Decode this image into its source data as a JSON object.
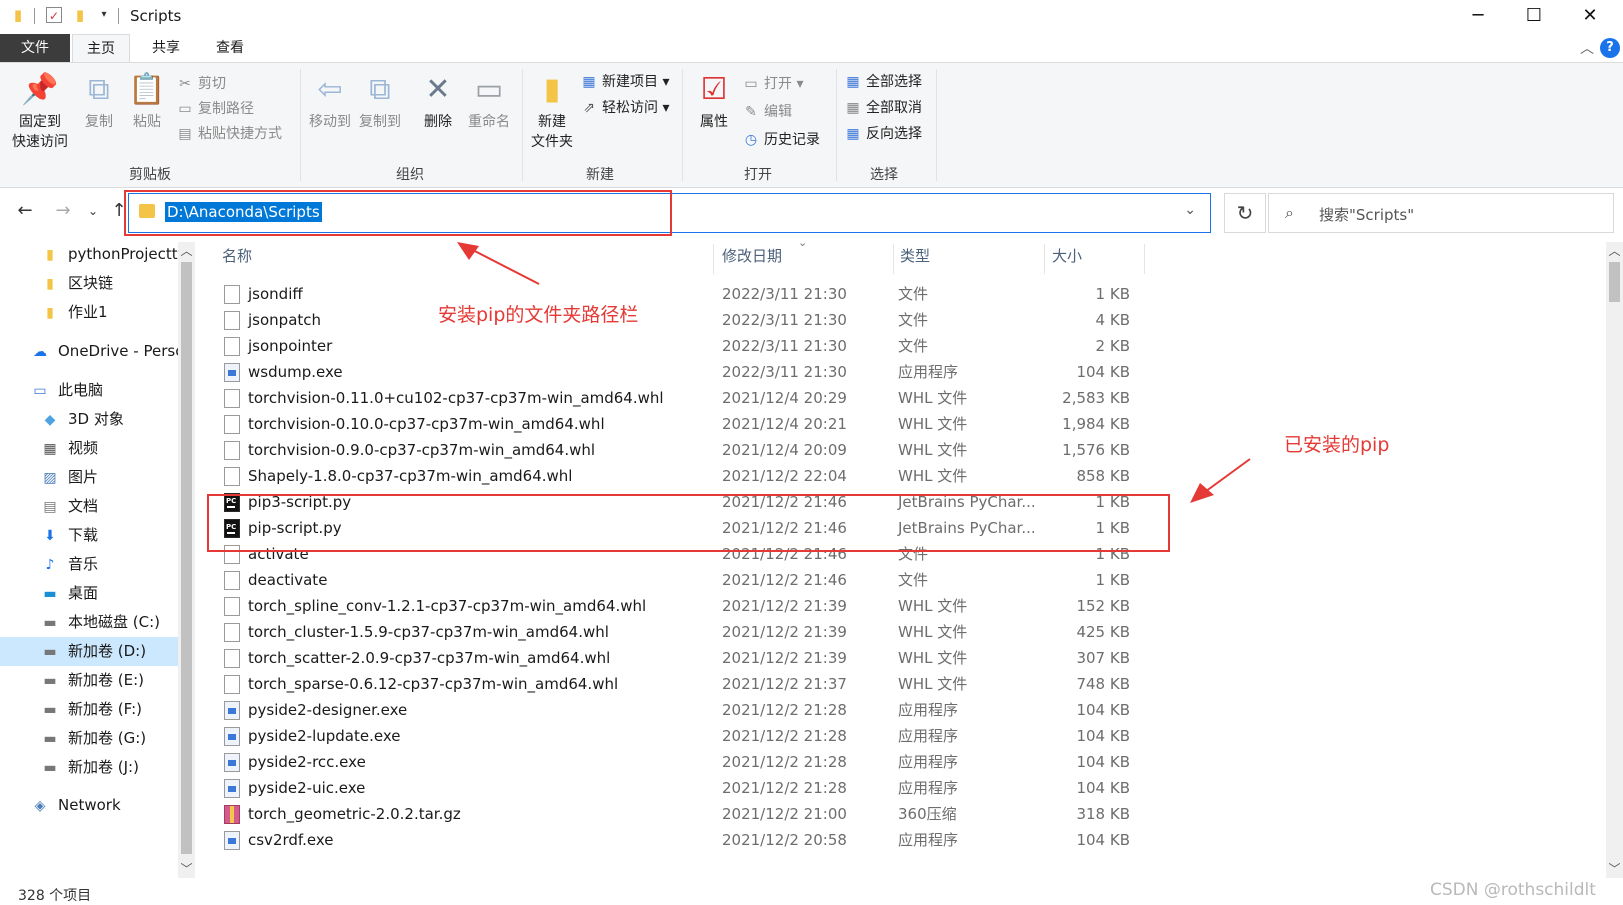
{
  "window": {
    "title": "Scripts",
    "controls": {
      "minimize": "─",
      "maximize": "☐",
      "close": "✕"
    }
  },
  "ribbon": {
    "tabs": [
      "文件",
      "主页",
      "共享",
      "查看"
    ],
    "help": "?",
    "groups": {
      "clipboard": {
        "label": "剪贴板",
        "pin": "固定到\n快速访问",
        "pin_l1": "固定到",
        "pin_l2": "快速访问",
        "copy": "复制",
        "paste": "粘贴",
        "cut": "剪切",
        "copy_path": "复制路径",
        "paste_shortcut": "粘贴快捷方式"
      },
      "organize": {
        "label": "组织",
        "move_to": "移动到",
        "copy_to": "复制到",
        "delete": "删除",
        "rename": "重命名"
      },
      "new": {
        "label": "新建",
        "new_folder_l1": "新建",
        "new_folder_l2": "文件夹",
        "new_item": "新建项目",
        "easy_access": "轻松访问"
      },
      "open": {
        "label": "打开",
        "properties": "属性",
        "open": "打开",
        "edit": "编辑",
        "history": "历史记录"
      },
      "select": {
        "label": "选择",
        "select_all": "全部选择",
        "select_none": "全部取消",
        "invert": "反向选择"
      }
    }
  },
  "address": {
    "path": "D:\\Anaconda\\Scripts",
    "search_placeholder": "搜索\"Scripts\""
  },
  "nav": {
    "items": [
      {
        "label": "pythonProjectt",
        "icon": "folder-icon"
      },
      {
        "label": "区块链",
        "icon": "folder-icon"
      },
      {
        "label": "作业1",
        "icon": "folder-icon"
      },
      {
        "label": "OneDrive - Persc",
        "icon": "cloud-icon"
      },
      {
        "label": "此电脑",
        "icon": "computer-icon"
      },
      {
        "label": "3D 对象",
        "icon": "cube-icon"
      },
      {
        "label": "视频",
        "icon": "video-icon"
      },
      {
        "label": "图片",
        "icon": "picture-icon"
      },
      {
        "label": "文档",
        "icon": "document-icon"
      },
      {
        "label": "下载",
        "icon": "download-icon"
      },
      {
        "label": "音乐",
        "icon": "music-icon"
      },
      {
        "label": "桌面",
        "icon": "desktop-icon"
      },
      {
        "label": "本地磁盘 (C:)",
        "icon": "drive-icon"
      },
      {
        "label": "新加卷 (D:)",
        "icon": "drive-icon"
      },
      {
        "label": "新加卷 (E:)",
        "icon": "drive-icon"
      },
      {
        "label": "新加卷 (F:)",
        "icon": "drive-icon"
      },
      {
        "label": "新加卷 (G:)",
        "icon": "drive-icon"
      },
      {
        "label": "新加卷 (J:)",
        "icon": "drive-icon"
      },
      {
        "label": "Network",
        "icon": "network-icon"
      }
    ],
    "selected": "新加卷 (D:)"
  },
  "columns": {
    "name": "名称",
    "date": "修改日期",
    "type": "类型",
    "size": "大小"
  },
  "files": [
    {
      "name": "jsondiff",
      "date": "2022/3/11 21:30",
      "type": "文件",
      "size": "1 KB",
      "icon": "file"
    },
    {
      "name": "jsonpatch",
      "date": "2022/3/11 21:30",
      "type": "文件",
      "size": "4 KB",
      "icon": "file"
    },
    {
      "name": "jsonpointer",
      "date": "2022/3/11 21:30",
      "type": "文件",
      "size": "2 KB",
      "icon": "file"
    },
    {
      "name": "wsdump.exe",
      "date": "2022/3/11 21:30",
      "type": "应用程序",
      "size": "104 KB",
      "icon": "exe"
    },
    {
      "name": "torchvision-0.11.0+cu102-cp37-cp37m-win_amd64.whl",
      "date": "2021/12/4 20:29",
      "type": "WHL 文件",
      "size": "2,583 KB",
      "icon": "file"
    },
    {
      "name": "torchvision-0.10.0-cp37-cp37m-win_amd64.whl",
      "date": "2021/12/4 20:21",
      "type": "WHL 文件",
      "size": "1,984 KB",
      "icon": "file"
    },
    {
      "name": "torchvision-0.9.0-cp37-cp37m-win_amd64.whl",
      "date": "2021/12/4 20:09",
      "type": "WHL 文件",
      "size": "1,576 KB",
      "icon": "file"
    },
    {
      "name": "Shapely-1.8.0-cp37-cp37m-win_amd64.whl",
      "date": "2021/12/2 22:04",
      "type": "WHL 文件",
      "size": "858 KB",
      "icon": "file"
    },
    {
      "name": "pip3-script.py",
      "date": "2021/12/2 21:46",
      "type": "JetBrains PyChar...",
      "size": "1 KB",
      "icon": "py"
    },
    {
      "name": "pip-script.py",
      "date": "2021/12/2 21:46",
      "type": "JetBrains PyChar...",
      "size": "1 KB",
      "icon": "py"
    },
    {
      "name": "activate",
      "date": "2021/12/2 21:46",
      "type": "文件",
      "size": "1 KB",
      "icon": "file"
    },
    {
      "name": "deactivate",
      "date": "2021/12/2 21:46",
      "type": "文件",
      "size": "1 KB",
      "icon": "file"
    },
    {
      "name": "torch_spline_conv-1.2.1-cp37-cp37m-win_amd64.whl",
      "date": "2021/12/2 21:39",
      "type": "WHL 文件",
      "size": "152 KB",
      "icon": "file"
    },
    {
      "name": "torch_cluster-1.5.9-cp37-cp37m-win_amd64.whl",
      "date": "2021/12/2 21:39",
      "type": "WHL 文件",
      "size": "425 KB",
      "icon": "file"
    },
    {
      "name": "torch_scatter-2.0.9-cp37-cp37m-win_amd64.whl",
      "date": "2021/12/2 21:39",
      "type": "WHL 文件",
      "size": "307 KB",
      "icon": "file"
    },
    {
      "name": "torch_sparse-0.6.12-cp37-cp37m-win_amd64.whl",
      "date": "2021/12/2 21:37",
      "type": "WHL 文件",
      "size": "748 KB",
      "icon": "file"
    },
    {
      "name": "pyside2-designer.exe",
      "date": "2021/12/2 21:28",
      "type": "应用程序",
      "size": "104 KB",
      "icon": "exe"
    },
    {
      "name": "pyside2-lupdate.exe",
      "date": "2021/12/2 21:28",
      "type": "应用程序",
      "size": "104 KB",
      "icon": "exe"
    },
    {
      "name": "pyside2-rcc.exe",
      "date": "2021/12/2 21:28",
      "type": "应用程序",
      "size": "104 KB",
      "icon": "exe"
    },
    {
      "name": "pyside2-uic.exe",
      "date": "2021/12/2 21:28",
      "type": "应用程序",
      "size": "104 KB",
      "icon": "exe"
    },
    {
      "name": "torch_geometric-2.0.2.tar.gz",
      "date": "2021/12/2 21:00",
      "type": "360压缩",
      "size": "318 KB",
      "icon": "gz"
    },
    {
      "name": "csv2rdf.exe",
      "date": "2021/12/2 20:58",
      "type": "应用程序",
      "size": "104 KB",
      "icon": "exe"
    }
  ],
  "status": {
    "count": "328 个项目"
  },
  "annotations": {
    "address_note": "安装pip的文件夹路径栏",
    "pip_note": "已安装的pip"
  },
  "watermark": "CSDN @rothschildlt",
  "colors": {
    "annotation": "#e53935",
    "accent": "#0078d7",
    "selected_nav": "#cce8ff"
  }
}
